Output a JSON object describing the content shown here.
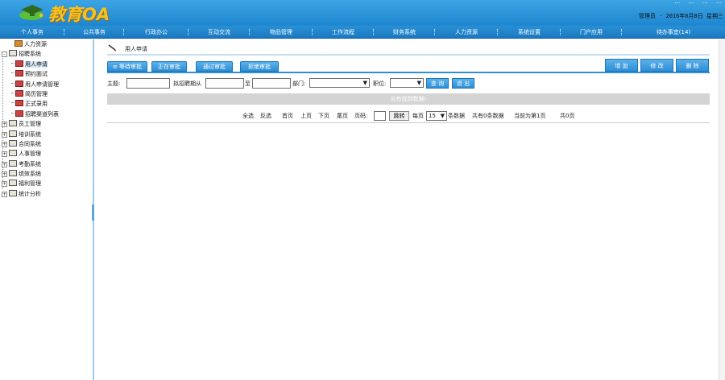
{
  "app": {
    "logo_text": "教育OA",
    "top_links": [
      "…",
      "…",
      "…",
      "…"
    ],
    "user_info": "管理员 · 2016年6月8日 星期三"
  },
  "nav": {
    "items": [
      "个人事务",
      "公共事务",
      "行政办公",
      "互动交流",
      "物品管理",
      "工作流程",
      "财务系统",
      "人力资源",
      "系统设置",
      "门户应用",
      "待办事宜(14)"
    ]
  },
  "sidebar": {
    "root": "人力资源",
    "items": [
      {
        "label": "招聘系统",
        "level": 0,
        "expander": "-"
      },
      {
        "label": "用人申请",
        "level": 1,
        "selected": true
      },
      {
        "label": "预约面试",
        "level": 1
      },
      {
        "label": "用人申请管理",
        "level": 1
      },
      {
        "label": "简历管理",
        "level": 1
      },
      {
        "label": "正式录用",
        "level": 1
      },
      {
        "label": "招聘渠道列表",
        "level": 1
      },
      {
        "label": "员工管理",
        "level": 0,
        "expander": "+"
      },
      {
        "label": "培训系统",
        "level": 0,
        "expander": "+"
      },
      {
        "label": "合同系统",
        "level": 0,
        "expander": "+"
      },
      {
        "label": "人事管理",
        "level": 0,
        "expander": "+"
      },
      {
        "label": "考勤系统",
        "level": 0,
        "expander": "+"
      },
      {
        "label": "绩效系统",
        "level": 0,
        "expander": "+"
      },
      {
        "label": "福利管理",
        "level": 0,
        "expander": "+"
      },
      {
        "label": "统计分析",
        "level": 0,
        "expander": "+"
      }
    ]
  },
  "main": {
    "breadcrumb": "用人申请",
    "tabs": [
      "≡ 等待审批",
      "正在审批",
      "通过审批",
      "拒绝审批"
    ],
    "actions": [
      "增 加",
      "修 改",
      "删 除"
    ],
    "search": {
      "subject_label": "主题:",
      "date_label": "拟招聘期从",
      "date_to_label": "至",
      "dept_label": "部门:",
      "position_label": "职位:",
      "query_button": "查 询",
      "exit_button": "退 出"
    },
    "no_data": "没有找到数据!",
    "pager": {
      "select_all": "全选",
      "invert": "反选",
      "first": "首页",
      "prev": "上页",
      "next": "下页",
      "last": "尾页",
      "page_label": "页码:",
      "jump": "跳转",
      "per_page_label": "每页",
      "per_page_value": "15",
      "per_page_suffix": "条数据",
      "total": "共有0条数据",
      "current": "当前为第1页",
      "pages": "共0页"
    }
  }
}
